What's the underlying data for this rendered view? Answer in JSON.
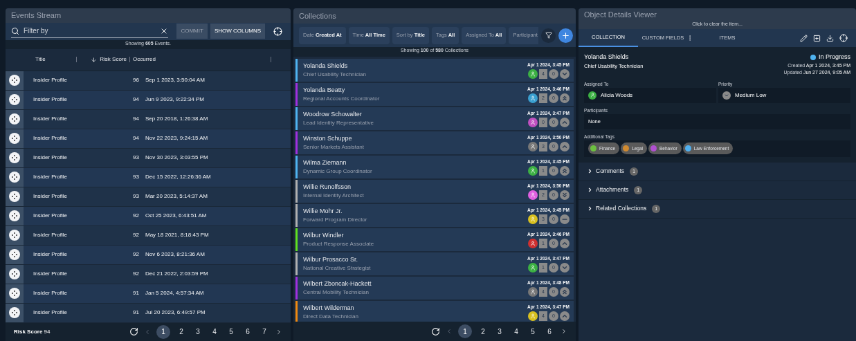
{
  "events": {
    "title": "Events Stream",
    "filter": {
      "placeholder": "Filter by"
    },
    "commit_button": {
      "label": "COMMIT",
      "disabled": true
    },
    "columns_button": {
      "label": "SHOW COLUMNS"
    },
    "summary": {
      "prefix": "Showing",
      "count": "605",
      "suffix": "Events."
    },
    "columns": [
      "Title",
      "Risk Score",
      "Occurred"
    ],
    "rows": [
      {
        "title": "Insider Profile",
        "score": "96",
        "occurred": "Sep 1 2023, 3:50:04 AM"
      },
      {
        "title": "Insider Profile",
        "score": "94",
        "occurred": "Jun 9 2023, 9:22:34 PM"
      },
      {
        "title": "Insider Profile",
        "score": "94",
        "occurred": "Sep 20 2018, 1:26:38 AM"
      },
      {
        "title": "Insider Profile",
        "score": "94",
        "occurred": "Nov 22 2023, 9:24:15 AM"
      },
      {
        "title": "Insider Profile",
        "score": "93",
        "occurred": "Nov 30 2023, 3:03:55 PM"
      },
      {
        "title": "Insider Profile",
        "score": "93",
        "occurred": "Dec 15 2022, 12:26:36 AM"
      },
      {
        "title": "Insider Profile",
        "score": "93",
        "occurred": "Mar 20 2023, 5:14:37 AM"
      },
      {
        "title": "Insider Profile",
        "score": "92",
        "occurred": "Oct 25 2023, 6:43:51 AM"
      },
      {
        "title": "Insider Profile",
        "score": "92",
        "occurred": "May 18 2021, 8:18:43 PM"
      },
      {
        "title": "Insider Profile",
        "score": "92",
        "occurred": "Nov 6 2023, 8:21:36 AM"
      },
      {
        "title": "Insider Profile",
        "score": "92",
        "occurred": "Dec 21 2022, 2:03:59 PM"
      },
      {
        "title": "Insider Profile",
        "score": "91",
        "occurred": "Jan 5 2024, 4:57:34 AM"
      },
      {
        "title": "Insider Profile",
        "score": "91",
        "occurred": "Jul 20 2023, 6:49:57 PM"
      }
    ],
    "footer": {
      "label": "Risk Score",
      "value": "94"
    },
    "pages": [
      {
        "label": "1",
        "selected": true
      },
      {
        "label": "2",
        "selected": false
      },
      {
        "label": "3",
        "selected": false
      },
      {
        "label": "4",
        "selected": false
      },
      {
        "label": "5",
        "selected": false
      },
      {
        "label": "6",
        "selected": false
      },
      {
        "label": "7",
        "selected": false
      }
    ]
  },
  "collections": {
    "title": "Collections",
    "filters": [
      {
        "label": "Date",
        "value": "Created At"
      },
      {
        "label": "Time",
        "value": "All Time"
      },
      {
        "label": "Sort by",
        "value": "Title"
      },
      {
        "label": "Tags",
        "value": "All"
      },
      {
        "label": "Assigned To",
        "value": "All"
      },
      {
        "label": "Participant"
      }
    ],
    "summary": {
      "prefix": "Showing",
      "shown": "100",
      "middle": "of",
      "total": "580",
      "suffix": "Collections"
    },
    "items": [
      {
        "name": "Yolanda Shields",
        "role": "Chief Usability Technician",
        "time": "Apr 1 2024, 3:45 PM",
        "color": "#4fb3f0",
        "avatar": {
          "color": "#3cb043"
        },
        "count": "4",
        "comments": "0",
        "priority": {
          "kind": "down"
        }
      },
      {
        "name": "Yolanda Beatty",
        "role": "Regional Accounts Coordinator",
        "time": "Apr 1 2024, 3:46 PM",
        "color": "#a030e0",
        "avatar": {
          "color": "#3aa0d0"
        },
        "count": "2",
        "comments": "0",
        "priority": {
          "kind": "double-up"
        }
      },
      {
        "name": "Woodrow Schowalter",
        "role": "Lead Identity Representative",
        "time": "Apr 1 2024, 3:47 PM",
        "color": "#4fb3f0",
        "avatar": {
          "color": "#c050c0"
        },
        "count": "0",
        "comments": "0",
        "priority": {
          "kind": "up"
        }
      },
      {
        "name": "Winston Schuppe",
        "role": "Senior Markets Assistant",
        "time": "Apr 1 2024, 3:50 PM",
        "color": "#a030e0",
        "avatar": {
          "color": "#777777"
        },
        "count": "3",
        "comments": "0",
        "priority": {
          "kind": "up"
        }
      },
      {
        "name": "Wilma Ziemann",
        "role": "Dynamic Group Coordinator",
        "time": "Apr 1 2024, 3:45 PM",
        "color": "#4fb3f0",
        "avatar": {
          "color": "#3cb043"
        },
        "count": "1",
        "comments": "0",
        "priority": {
          "kind": "double-up"
        }
      },
      {
        "name": "Willie Runolfsson",
        "role": "Internal Identity Architect",
        "time": "Apr 1 2024, 3:50 PM",
        "color": "#b0b0b0",
        "avatar": {
          "color": "#e060e0"
        },
        "count": "2",
        "comments": "0",
        "priority": {
          "kind": "double-down"
        }
      },
      {
        "name": "Willie Mohr Jr.",
        "role": "Forward Program Director",
        "time": "Apr 1 2024, 3:45 PM",
        "color": "#b0b0b0",
        "avatar": {
          "color": "#d8c020"
        },
        "count": "3",
        "comments": "0",
        "priority": {
          "kind": "none"
        }
      },
      {
        "name": "Wilbur Windler",
        "role": "Product Response Associate",
        "time": "Apr 1 2024, 3:46 PM",
        "color": "#60e020",
        "avatar": {
          "color": "#d03030"
        },
        "count": "1",
        "comments": "0",
        "priority": {
          "kind": "up"
        }
      },
      {
        "name": "Wilbur Prosacco Sr.",
        "role": "National Creative Strategist",
        "time": "Apr 1 2024, 3:47 PM",
        "color": "#b0b0b0",
        "avatar": {
          "color": "#3cb043"
        },
        "count": "1",
        "comments": "0",
        "priority": {
          "kind": "down"
        }
      },
      {
        "name": "Wilbert Zboncak-Hackett",
        "role": "Central Mobility Technician",
        "time": "Apr 1 2024, 3:48 PM",
        "color": "#a030e0",
        "avatar": {
          "color": "#777777"
        },
        "count": "4",
        "comments": "0",
        "priority": {
          "kind": "double-up"
        }
      },
      {
        "name": "Wilbert Wilderman",
        "role": "Direct Data Technician",
        "time": "Apr 1 2024, 3:47 PM",
        "color": "#f08a10",
        "avatar": {
          "color": "#d8c020"
        },
        "count": "4",
        "comments": "0",
        "priority": {
          "kind": "up"
        }
      }
    ],
    "pages": [
      {
        "label": "1",
        "selected": true
      },
      {
        "label": "2",
        "selected": false
      },
      {
        "label": "3",
        "selected": false
      },
      {
        "label": "4",
        "selected": false
      },
      {
        "label": "5",
        "selected": false
      },
      {
        "label": "6",
        "selected": false
      }
    ]
  },
  "details": {
    "title": "Object Details Viewer",
    "hint": "Click to clear the item...",
    "tabs": [
      {
        "label": "COLLECTION",
        "selected": true
      },
      {
        "label": "CUSTOM FIELDS",
        "selected": false
      },
      {
        "label": "ITEMS",
        "selected": false
      }
    ],
    "name": "Yolanda Shields",
    "role": "Chief Usability Technician",
    "status": {
      "label": "In Progress",
      "color": "#4fb3f0"
    },
    "created": {
      "label": "Created",
      "value": "Apr 1 2024, 3:45 PM"
    },
    "updated": {
      "label": "Updated",
      "value": "Jun 27 2024, 9:05 AM"
    },
    "assigned": {
      "label": "Assigned To",
      "value": "Alicia Woods"
    },
    "priority": {
      "label": "Priority",
      "value": "Medium Low"
    },
    "participants": {
      "label": "Participants",
      "value": "None"
    },
    "tags_label": "Additional Tags",
    "tags": [
      {
        "label": "Finance",
        "color": "#6cc040"
      },
      {
        "label": "Legal",
        "color": "#d08a30"
      },
      {
        "label": "Behavior",
        "color": "#b050d0"
      },
      {
        "label": "Law Enforcement",
        "color": "#50b0f0"
      }
    ],
    "sections": [
      {
        "label": "Comments",
        "count": "1",
        "expanded": false
      },
      {
        "label": "Attachments",
        "count": "1",
        "expanded": false
      },
      {
        "label": "Related Collections",
        "count": "1",
        "expanded": false
      }
    ]
  }
}
